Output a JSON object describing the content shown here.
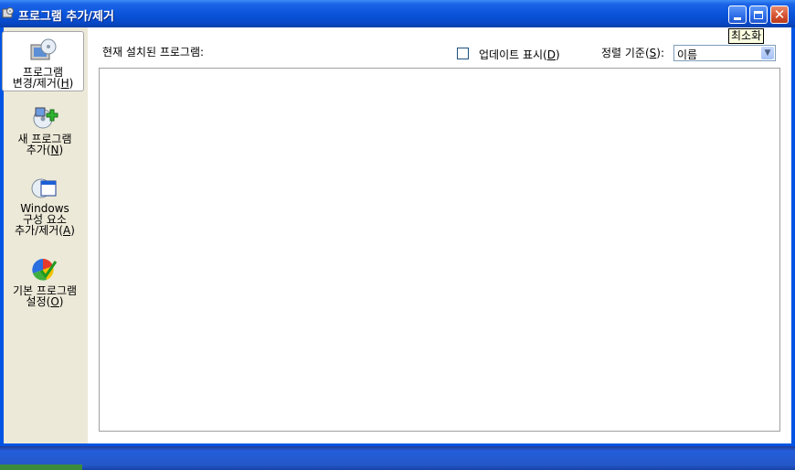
{
  "window": {
    "title": "프로그램 추가/제거"
  },
  "title_buttons": {
    "minimize_tooltip": "최소화"
  },
  "sidebar": {
    "items": [
      {
        "line1": "프로그램",
        "line2_pre": "변경/제거(",
        "mnemonic": "H",
        "line2_post": ")",
        "icon": "change-remove-programs-icon",
        "selected": true
      },
      {
        "line1": "새 프로그램",
        "line2_pre": "추가(",
        "mnemonic": "N",
        "line2_post": ")",
        "icon": "add-new-programs-icon",
        "selected": false
      },
      {
        "line1": "Windows",
        "line1b": "구성 요소",
        "line2_pre": "추가/제거(",
        "mnemonic": "A",
        "line2_post": ")",
        "icon": "windows-components-icon",
        "selected": false
      },
      {
        "line1": "기본 프로그램",
        "line2_pre": "설정(",
        "mnemonic": "O",
        "line2_post": ")",
        "icon": "default-programs-icon",
        "selected": false
      }
    ]
  },
  "main": {
    "installed_label": "현재 설치된 프로그램:",
    "show_updates_pre": "업데이트 표시(",
    "show_updates_mnemonic": "D",
    "show_updates_post": ")",
    "show_updates_checked": false,
    "sort_label_pre": "정렬 기준(",
    "sort_mnemonic": "S",
    "sort_label_post": "):",
    "sort_value": "이름"
  }
}
